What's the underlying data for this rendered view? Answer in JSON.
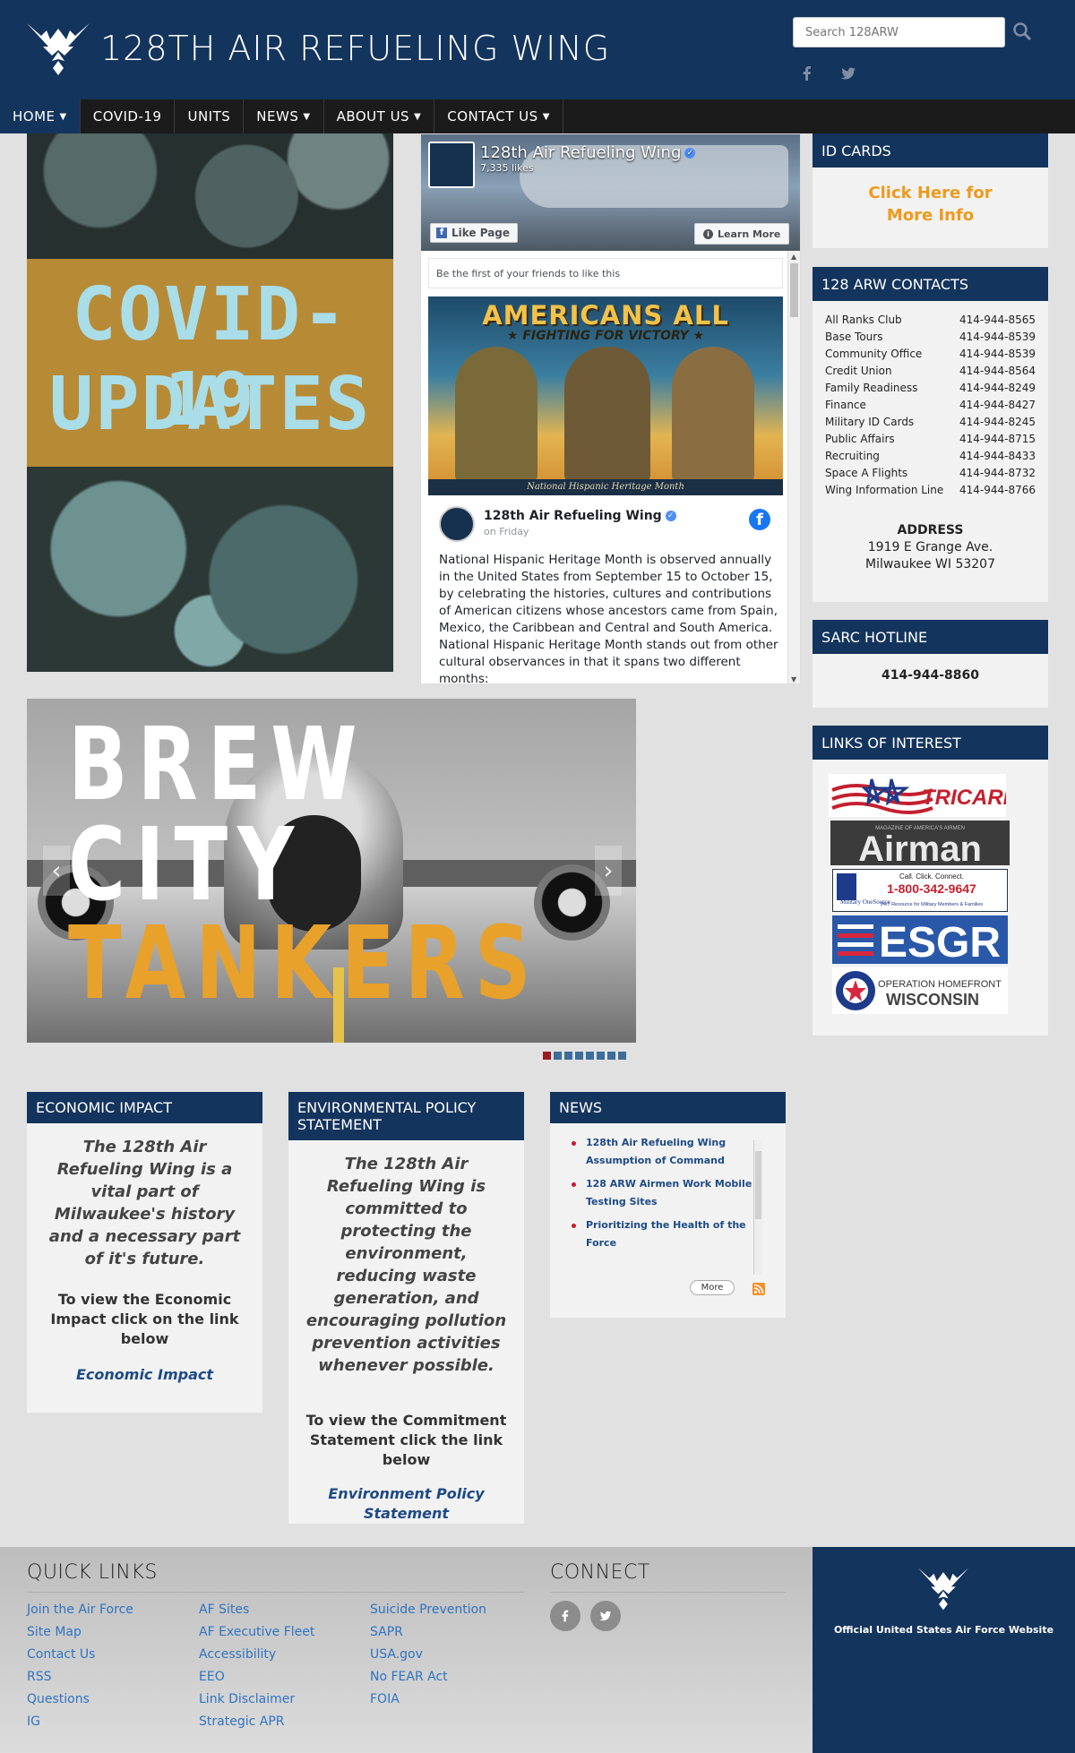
{
  "header": {
    "title": "128TH AIR REFUELING WING",
    "search_placeholder": "Search 128ARW"
  },
  "nav": {
    "items": [
      {
        "label": "HOME",
        "dropdown": true,
        "active": true
      },
      {
        "label": "COVID-19",
        "dropdown": false,
        "active": false
      },
      {
        "label": "UNITS",
        "dropdown": false,
        "active": false
      },
      {
        "label": "NEWS",
        "dropdown": true,
        "active": false
      },
      {
        "label": "ABOUT US",
        "dropdown": true,
        "active": false
      },
      {
        "label": "CONTACT US",
        "dropdown": true,
        "active": false
      }
    ]
  },
  "covid_banner": {
    "line1": "COVID-19",
    "line2": "UPDATES"
  },
  "facebook": {
    "page_name": "128th Air Refueling Wing",
    "likes": "7,335 likes",
    "like_button": "Like Page",
    "learn_more": "Learn More",
    "friends_text": "Be the first of your friends to like this",
    "poster_title": "AMERICANS ALL",
    "poster_subtitle": "★ FIGHTING FOR VICTORY ★",
    "poster_caption": "National Hispanic Heritage Month",
    "post_author": "128th Air Refueling Wing",
    "post_time": "on Friday",
    "post_text": "National Hispanic Heritage Month is observed annually in the United States from September 15 to October 15, by celebrating the histories, cultures and contributions of American citizens whose ancestors came from Spain, Mexico, the Caribbean and Central and South America. National Hispanic Heritage Month stands out from other cultural observances in that it spans two different months:"
  },
  "slider": {
    "word1": "BREW",
    "word2": "CITY",
    "word3": "TANKERS",
    "slide_count": 8,
    "active_slide": 1
  },
  "id_cards": {
    "title": "ID CARDS",
    "link": "Click Here for More Info"
  },
  "contacts": {
    "title": "128 ARW CONTACTS",
    "rows": [
      {
        "name": "All Ranks Club",
        "phone": "414-944-8565"
      },
      {
        "name": "Base Tours",
        "phone": "414-944-8539"
      },
      {
        "name": "Community Office",
        "phone": "414-944-8539"
      },
      {
        "name": "Credit Union",
        "phone": "414-944-8564"
      },
      {
        "name": "Family Readiness",
        "phone": "414-944-8249"
      },
      {
        "name": "Finance",
        "phone": "414-944-8427"
      },
      {
        "name": "Military ID Cards",
        "phone": "414-944-8245"
      },
      {
        "name": "Public Affairs",
        "phone": "414-944-8715"
      },
      {
        "name": "Recruiting",
        "phone": "414-944-8433"
      },
      {
        "name": "Space A Flights",
        "phone": "414-944-8732"
      },
      {
        "name": "Wing Information Line",
        "phone": "414-944-8766"
      }
    ],
    "address_label": "ADDRESS",
    "address_line1": "1919 E Grange Ave.",
    "address_line2": "Milwaukee WI 53207"
  },
  "sarc": {
    "title": "SARC HOTLINE",
    "phone": "414-944-8860"
  },
  "links_of_interest": {
    "title": "LINKS OF INTEREST",
    "tricare": "TRICARE",
    "airman": "Airman",
    "airman_sub": "MAGAZINE OF AMERICA'S AIRMEN",
    "mos_top": "Call. Click. Connect.",
    "mos_phone": "1-800-342-9647",
    "mos_brand": "Military OneSource",
    "mos_sub": "24/7 Resource for Military Members & Families",
    "esgr": "ESGR",
    "homefront_top": "OPERATION HOMEFRONT",
    "homefront_bottom": "WISCONSIN"
  },
  "economic": {
    "title": "ECONOMIC IMPACT",
    "statement": "The 128th Air Refueling Wing is a vital part of Milwaukee's history and a necessary part of it's future.",
    "instruction": "To view the Economic Impact click on the link below",
    "link": "Economic Impact"
  },
  "environmental": {
    "title": "ENVIRONMENTAL POLICY STATEMENT",
    "statement": "The 128th Air Refueling Wing is committed to protecting the environment, reducing waste generation, and encouraging pollution prevention activities whenever possible.",
    "instruction": "To view the Commitment Statement click the link below",
    "link": "Environment Policy Statement"
  },
  "news": {
    "title": "NEWS",
    "items": [
      "128th Air Refueling Wing Assumption of Command",
      "128 ARW Airmen Work Mobile Testing Sites",
      "Prioritizing the Health of the Force"
    ],
    "more": "More"
  },
  "footer": {
    "quick_links_title": "QUICK LINKS",
    "col1": [
      "Join the Air Force",
      "Site Map",
      "Contact Us",
      "RSS",
      "Questions",
      "IG"
    ],
    "col2": [
      "AF Sites",
      "AF Executive Fleet",
      "Accessibility",
      "EEO",
      "Link Disclaimer",
      "Strategic APR"
    ],
    "col3": [
      "Suicide Prevention",
      "SAPR",
      "USA.gov",
      "No FEAR Act",
      "FOIA"
    ],
    "connect_title": "CONNECT",
    "af_text": "Official United States Air Force Website"
  },
  "colors": {
    "brand_navy": "#13345d",
    "nav_black": "#1b1b1b",
    "orange_link": "#ee9a1c",
    "footer_link": "#2f73c1",
    "slide_active": "#9a1b1b"
  },
  "icons": [
    "air-force-wings-icon",
    "search-icon",
    "facebook-icon",
    "twitter-icon",
    "chevron-down-icon",
    "rss-icon"
  ]
}
